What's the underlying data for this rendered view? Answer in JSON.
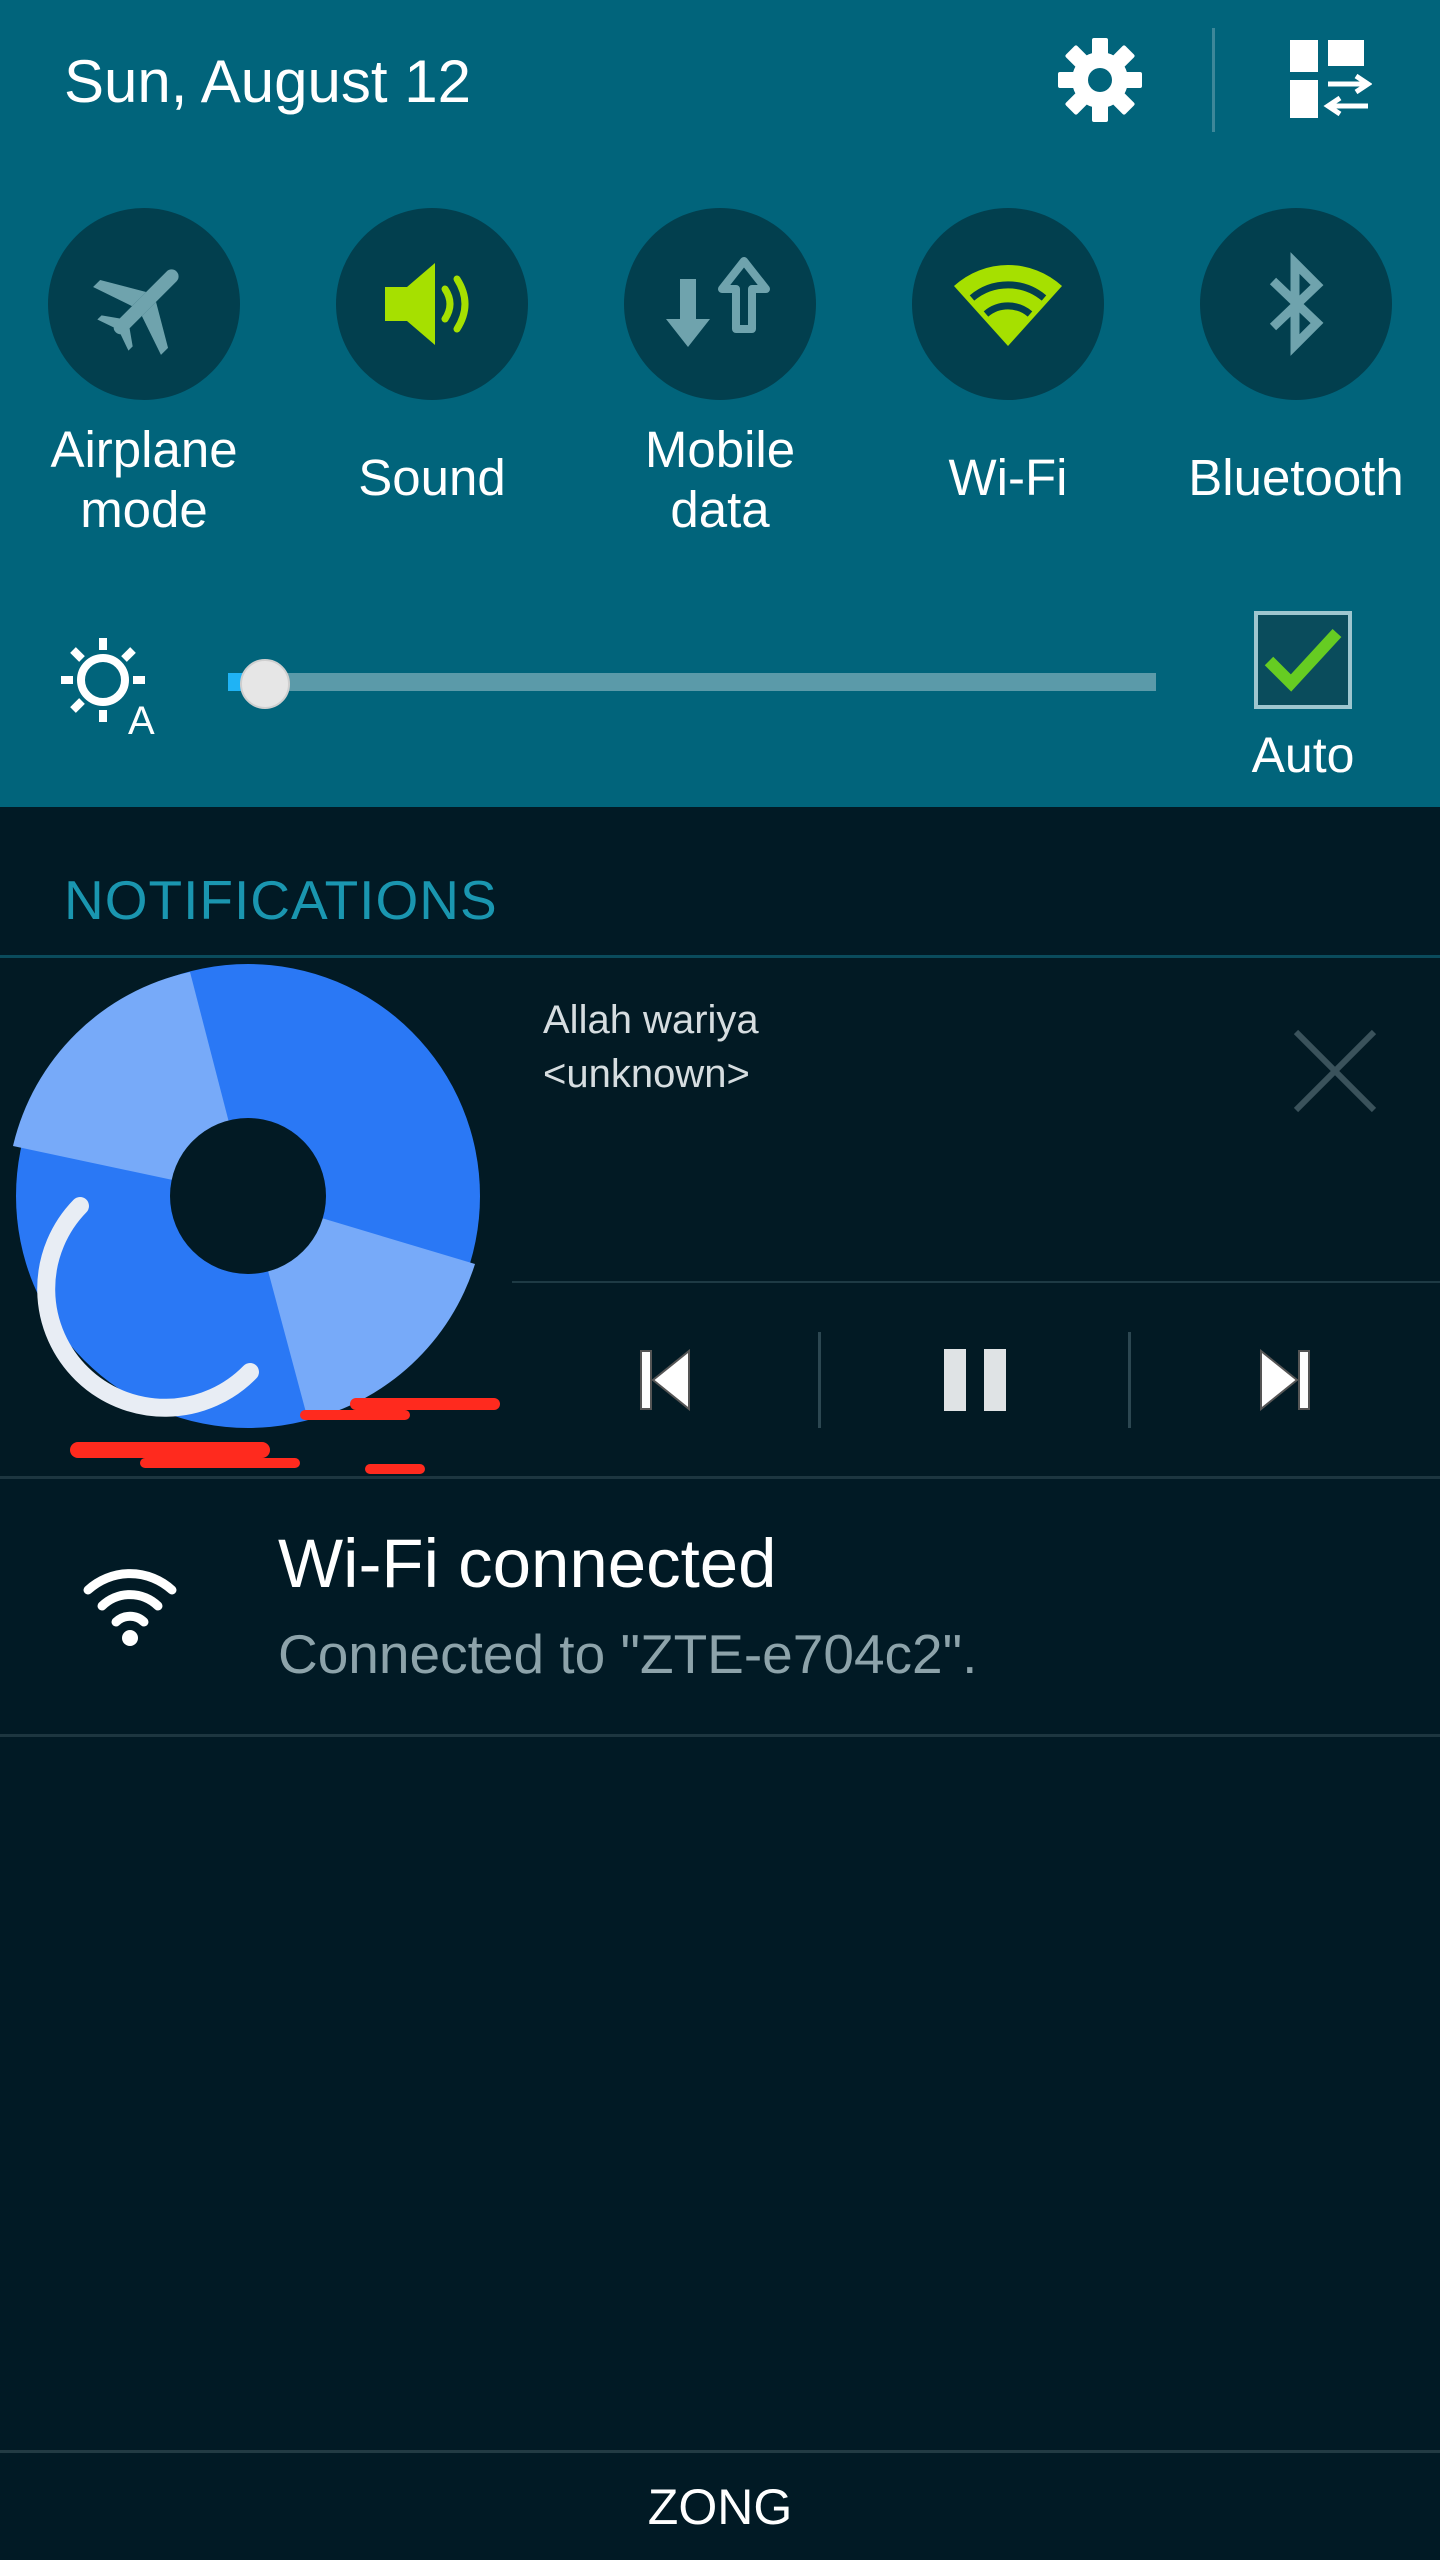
{
  "header": {
    "date": "Sun, August 12",
    "settings_icon": "gear-icon",
    "edit_icon": "grid-edit-icon"
  },
  "quick_settings": [
    {
      "id": "airplane",
      "label": "Airplane\nmode",
      "icon": "airplane-icon",
      "active": false
    },
    {
      "id": "sound",
      "label": "Sound",
      "icon": "speaker-icon",
      "active": true
    },
    {
      "id": "mobile-data",
      "label": "Mobile\ndata",
      "icon": "data-arrows-icon",
      "active": false
    },
    {
      "id": "wifi",
      "label": "Wi-Fi",
      "icon": "wifi-icon",
      "active": true
    },
    {
      "id": "bluetooth",
      "label": "Bluetooth",
      "icon": "bluetooth-icon",
      "active": false
    }
  ],
  "brightness": {
    "level": 0.04,
    "auto_label": "Auto",
    "auto_checked": true
  },
  "notifications": {
    "header": "NOTIFICATIONS",
    "music": {
      "title": "Allah wariya",
      "artist": "<unknown>"
    },
    "wifi": {
      "title": "Wi-Fi connected",
      "subtitle": "Connected to \"ZTE-e704c2\"."
    }
  },
  "carrier": "ZONG",
  "colors": {
    "panel": "#01647b",
    "active_green": "#a6e000",
    "inactive_icon": "#6fa3ad",
    "background": "#011a25",
    "accent_header": "#1a96b0"
  }
}
